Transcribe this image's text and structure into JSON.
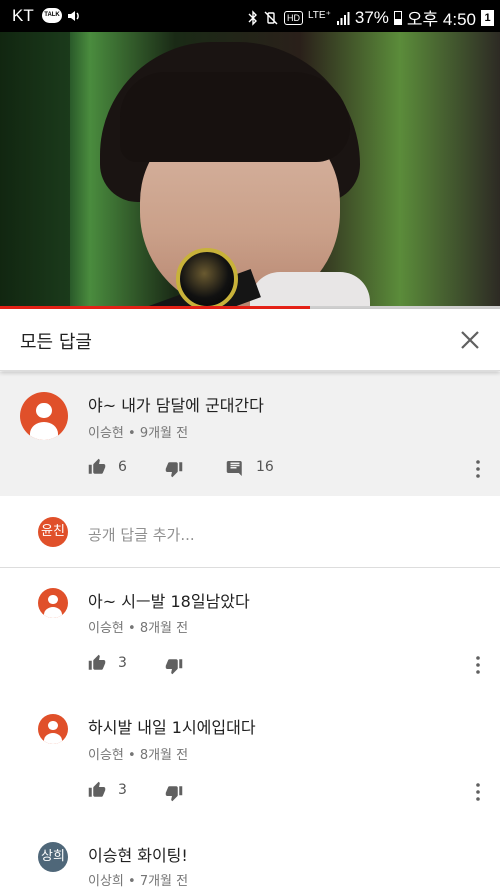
{
  "status_bar": {
    "carrier": "KT",
    "talk_badge": "TALK",
    "lte": "LTE⁺",
    "hd": "HD",
    "battery": "37%",
    "time": "오후 4:50",
    "notification": "1"
  },
  "video": {
    "progress_fraction": 0.62
  },
  "header": {
    "title": "모든 답글",
    "close_icon": "close-icon"
  },
  "top_comment": {
    "text": "야~ 내가 담달에 군대간다",
    "meta": "이승현 • 9개월 전",
    "likes": "6",
    "replies": "16"
  },
  "reply_input": {
    "avatar_text": "윤친",
    "placeholder": "공개 답글 추가..."
  },
  "replies": [
    {
      "text": "아~ 시ㅡ발 18일남았다",
      "meta": "이승현 • 8개월 전",
      "likes": "3"
    },
    {
      "text": "하시발 내일 1시에입대다",
      "meta": "이승현 • 8개월 전",
      "likes": "3"
    },
    {
      "text": "이승현 화이팅!",
      "meta": "이상희 • 7개월 전",
      "avatar_text": "상희"
    }
  ],
  "colors": {
    "accent_red": "#e62117",
    "avatar_red": "#e0502a",
    "avatar_slate": "#4f6779"
  }
}
